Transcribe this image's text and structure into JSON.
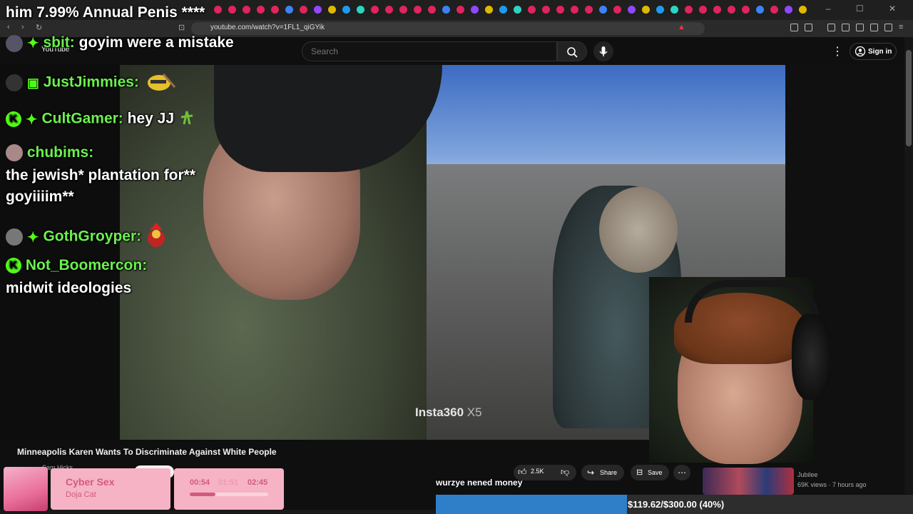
{
  "chat_top": {
    "text": "him 7.99% Annual Penis ****"
  },
  "browser": {
    "url": "youtube.com/watch?v=1FL1_qiGYik"
  },
  "youtube": {
    "logo": "YouTube",
    "search_placeholder": "Search",
    "sign_in": "Sign in",
    "video_title": "Minneapolis Karen Wants To Discriminate Against White People",
    "channel": "Sam Hicks",
    "likes": "2.5K",
    "share": "Share",
    "save": "Save",
    "watermark_brand": "Insta360",
    "watermark_model": "X5",
    "rec": {
      "channel": "Jubilee",
      "meta": "69K views · 7 hours ago"
    }
  },
  "chat": [
    {
      "user": "sbit:",
      "message": "goyim were a mistake"
    },
    {
      "user": "JustJimmies:",
      "message": ""
    },
    {
      "user": "CultGamer:",
      "message": "hey JJ"
    },
    {
      "user": "chubims:",
      "message": "the jewish* plantation for**"
    },
    {
      "user": "",
      "message": "goyiiiim**"
    },
    {
      "user": "GothGroyper:",
      "message": ""
    },
    {
      "user": "Not_Boomercon:",
      "message": "midwit ideologies"
    }
  ],
  "overlay": {
    "donation": "wurzye nened money",
    "goal_text": "$119.62/$300.00 (40%)",
    "goal_fraction": 0.4
  },
  "music": {
    "title": "Cyber Sex",
    "artist": "Doja Cat",
    "elapsed": "00:54",
    "middle": "01:51",
    "total": "02:45",
    "progress_fraction": 0.33
  },
  "colors": {
    "chat_username": "#6bf04d",
    "kick_green": "#53fc18",
    "goal_fill": "#2f7fc8",
    "spotify_pink": "#f5b3c5"
  }
}
